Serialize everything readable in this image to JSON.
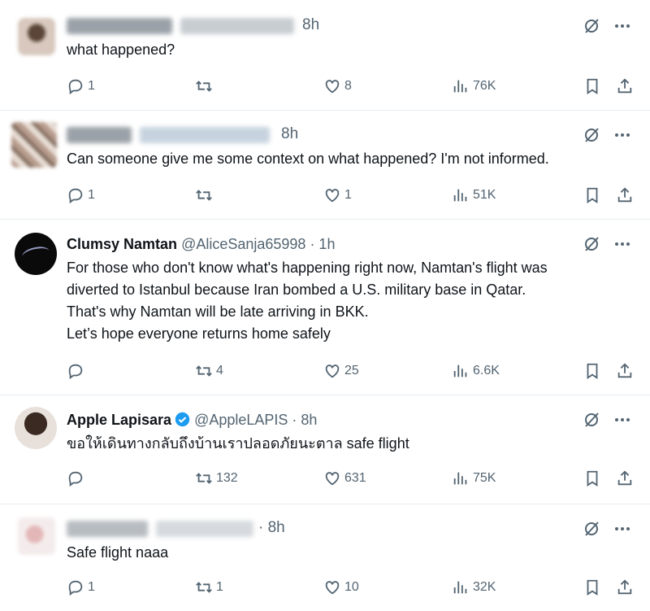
{
  "tweets": [
    {
      "display_name": "",
      "handle": "",
      "time": "8h",
      "lines": [
        "what happened?"
      ],
      "replies": "1",
      "retweets": "",
      "likes": "8",
      "views": "76K"
    },
    {
      "display_name": "",
      "handle": "",
      "time": "8h",
      "lines": [
        "Can someone give me some context on what happened? I'm not informed."
      ],
      "replies": "1",
      "retweets": "",
      "likes": "1",
      "views": "51K"
    },
    {
      "display_name": "Clumsy Namtan",
      "handle": "@AliceSanja65998 · 1h",
      "time": "",
      "lines": [
        "For those who don't know what's happening right now, Namtan's flight was",
        "diverted to Istanbul because Iran bombed a U.S. military base in Qatar.",
        "That's why Namtan will be late arriving in BKK.",
        "Let’s hope everyone returns home safely"
      ],
      "replies": "",
      "retweets": "4",
      "likes": "25",
      "views": "6.6K"
    },
    {
      "display_name": "Apple Lapisara",
      "handle": "@AppleLAPIS · 8h",
      "time": "",
      "lines": [
        "ขอให้เดินทางกลับถึงบ้านเราปลอดภัยนะตาล safe flight"
      ],
      "replies": "",
      "retweets": "132",
      "likes": "631",
      "views": "75K"
    },
    {
      "display_name": "",
      "handle": "",
      "time": "· 8h",
      "lines": [
        "Safe flight naaa"
      ],
      "replies": "1",
      "retweets": "1",
      "likes": "10",
      "views": "32K"
    }
  ],
  "icons": {
    "reply": "reply-icon",
    "retweet": "retweet-icon",
    "like": "heart-icon",
    "views": "views-icon",
    "bookmark": "bookmark-icon",
    "share": "share-icon",
    "grok": "grok-icon",
    "more": "more-icon",
    "verified": "verified-badge-icon"
  },
  "colors": {
    "text": "#0f1419",
    "secondary": "#536471",
    "verified": "#1d9bf0",
    "divider": "#e6ecf0"
  }
}
